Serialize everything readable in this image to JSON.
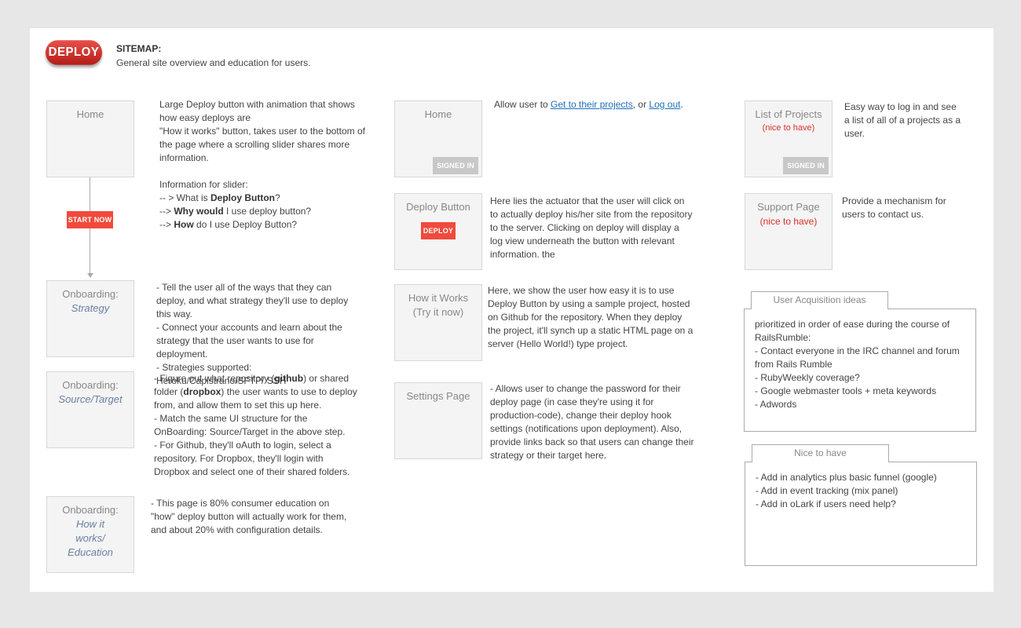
{
  "header": {
    "logo": "DEPLOY",
    "title": "SITEMAP:",
    "subtitle": "General site overview and education for users."
  },
  "col1": {
    "home": {
      "label": "Home",
      "desc": [
        "Large Deploy button with animation that shows how easy deploys are",
        "\"How it works\" button, takes user to the bottom of the page where a scrolling slider shares more information."
      ],
      "slider_heading": "Information for slider:",
      "slider_items": [
        {
          "pre": "-- > What is ",
          "bold": "Deploy Button",
          "post": "?"
        },
        {
          "pre": "--> ",
          "bold": "Why would",
          "post": " I use deploy button?"
        },
        {
          "pre": "-->  ",
          "bold": "How",
          "post": " do I use Deploy Button?"
        }
      ]
    },
    "start_now": "START NOW",
    "strategy": {
      "label": "Onboarding:",
      "sub": "Strategy",
      "desc": "- Tell the user all of the ways that they can deploy, and what  strategy they'll use to deploy this way.\n-  Connect your accounts and learn about the strategy that the user wants to use for deployment.\n- Strategies supported: Heroku/Capistrano/SFTP/ SSH"
    },
    "source": {
      "label": "Onboarding:",
      "sub": "Source/Target",
      "desc_parts": {
        "p1": "-  Figure out what repository (",
        "b1": "github",
        "p2": ") or shared folder (",
        "b2": "dropbox",
        "p3": ")  the user wants to use to deploy from, and allow them to set this up here.\n- Match the same UI structure for the OnBoarding: Source/Target in the above step.\n- For Github, they'll oAuth to login, select a repository.  For Dropbox, they'll login with Dropbox and select one of their shared folders."
      }
    },
    "education": {
      "label": "Onboarding:",
      "sub": "How it works/ Education",
      "desc": "- This page is 80% consumer education on \"how\" deploy button will actually work for them, and about 20% with configuration details."
    }
  },
  "col2": {
    "home": {
      "label": "Home",
      "badge": "SIGNED IN",
      "desc_pre": "Allow user to ",
      "link1": "Get to their projects",
      "desc_mid": ", or ",
      "link2": "Log out",
      "desc_post": "."
    },
    "deploy": {
      "label": "Deploy Button",
      "button": "DEPLOY",
      "desc": "Here lies the actuator that the user will click on to actually deploy his/her site from the repository to the server.   Clicking on deploy will display a log view underneath the button with relevant information.   the"
    },
    "how": {
      "label": "How it Works",
      "sub": "(Try it now)",
      "desc": "Here, we show the user how easy it is to use Deploy Button by using a sample project, hosted on Github for the repository.   When they deploy the project, it'll synch up a static HTML page on a server (Hello World!) type project."
    },
    "settings": {
      "label": "Settings Page",
      "desc": "- Allows user to change the password for their deploy page (in case they're using it for production-code), change their deploy hook settings (notifications upon deployment).   Also, provide links back so that users can change their strategy or their target here."
    }
  },
  "col3": {
    "projects": {
      "label": "List of Projects",
      "nice": "(nice to have)",
      "badge": "SIGNED IN",
      "desc": "Easy way to log in and see a list of all of a projects as a user."
    },
    "support": {
      "label": "Support Page",
      "nice": "(nice to have)",
      "desc": "Provide a mechanism for users to contact us."
    },
    "acquisition": {
      "tab": "User Acquisition ideas",
      "text": "prioritized in order of ease during the course of RailsRumble:\n- Contact everyone in the IRC channel and forum from Rails Rumble\n- RubyWeekly coverage?\n- Google webmaster tools + meta keywords\n- Adwords"
    },
    "nice": {
      "tab": "Nice to have",
      "text": "- Add in analytics plus basic funnel (google)\n- Add in event tracking (mix panel)\n- Add in oLark if users need help?"
    }
  }
}
